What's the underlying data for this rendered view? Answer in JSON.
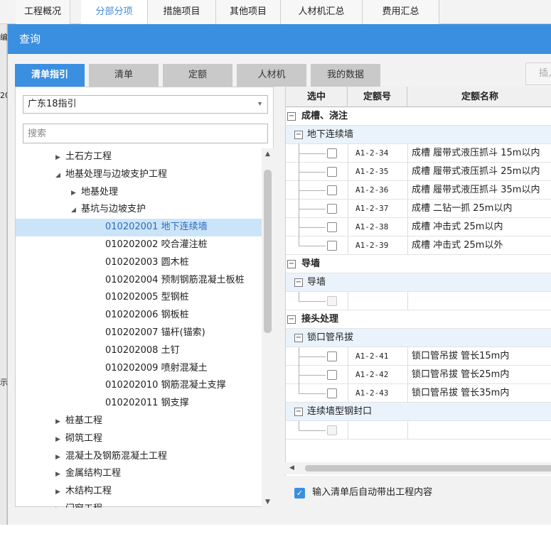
{
  "top_tabs": [
    "工程概况",
    "分部分项",
    "措施项目",
    "其他项目",
    "人材机汇总",
    "费用汇总"
  ],
  "background_fragments": [
    "编",
    "20",
    "示"
  ],
  "dialog": {
    "title": "查询",
    "tabs": [
      "清单指引",
      "清单",
      "定额",
      "人材机",
      "我的数据"
    ],
    "insert_label": "插入"
  },
  "left": {
    "guide_select": "广东18指引",
    "search_placeholder": "搜索",
    "tree": [
      {
        "label": "土石方工程",
        "expanded": false
      },
      {
        "label": "地基处理与边坡支护工程",
        "expanded": true
      },
      {
        "label": "地基处理",
        "expanded": false
      },
      {
        "label": "基坑与边坡支护",
        "expanded": true
      },
      {
        "label": "010202001  地下连续墙"
      },
      {
        "label": "010202002  咬合灌注桩"
      },
      {
        "label": "010202003  圆木桩"
      },
      {
        "label": "010202004  预制钢筋混凝土板桩"
      },
      {
        "label": "010202005  型钢桩"
      },
      {
        "label": "010202006  钢板桩"
      },
      {
        "label": "010202007  锚杆(锚索)"
      },
      {
        "label": "010202008  土钉"
      },
      {
        "label": "010202009  喷射混凝土"
      },
      {
        "label": "010202010  钢筋混凝土支撑"
      },
      {
        "label": "010202011  钢支撑"
      },
      {
        "label": "桩基工程",
        "expanded": false
      },
      {
        "label": "砌筑工程",
        "expanded": false
      },
      {
        "label": "混凝土及钢筋混凝土工程",
        "expanded": false
      },
      {
        "label": "金属结构工程",
        "expanded": false
      },
      {
        "label": "木结构工程",
        "expanded": false
      },
      {
        "label": "门窗工程",
        "expanded": false
      }
    ]
  },
  "grid": {
    "headers": [
      "选中",
      "定额号",
      "定额名称"
    ],
    "groups": [
      {
        "label": "成槽、浇注",
        "subs": [
          {
            "label": "地下连续墙",
            "rows": [
              {
                "code": "A1-2-34",
                "name": "成槽 履带式液压抓斗 15m以内"
              },
              {
                "code": "A1-2-35",
                "name": "成槽 履带式液压抓斗 25m以内"
              },
              {
                "code": "A1-2-36",
                "name": "成槽 履带式液压抓斗 35m以内"
              },
              {
                "code": "A1-2-37",
                "name": "成槽 二钻一抓 25m以内"
              },
              {
                "code": "A1-2-38",
                "name": "成槽 冲击式 25m以内"
              },
              {
                "code": "A1-2-39",
                "name": "成槽 冲击式 25m以外"
              }
            ]
          }
        ]
      },
      {
        "label": "导墙",
        "subs": [
          {
            "label": "导墙",
            "rows": [
              {
                "code": "",
                "name": "",
                "disabled": true
              }
            ]
          }
        ]
      },
      {
        "label": "接头处理",
        "subs": [
          {
            "label": "锁口管吊拔",
            "rows": [
              {
                "code": "A1-2-41",
                "name": "锁口管吊拔 管长15m内"
              },
              {
                "code": "A1-2-42",
                "name": "锁口管吊拔 管长25m内"
              },
              {
                "code": "A1-2-43",
                "name": "锁口管吊拔 管长35m内"
              }
            ]
          },
          {
            "label": "连续墙型钢封口",
            "rows": [
              {
                "code": "",
                "name": "",
                "disabled": true
              }
            ]
          }
        ]
      }
    ]
  },
  "auto_option": "输入清单后自动带出工程内容",
  "colors": {
    "accent": "#3b8fe0",
    "selected_bg": "#cce4f7",
    "sub_row_bg": "#eaf3fc"
  }
}
